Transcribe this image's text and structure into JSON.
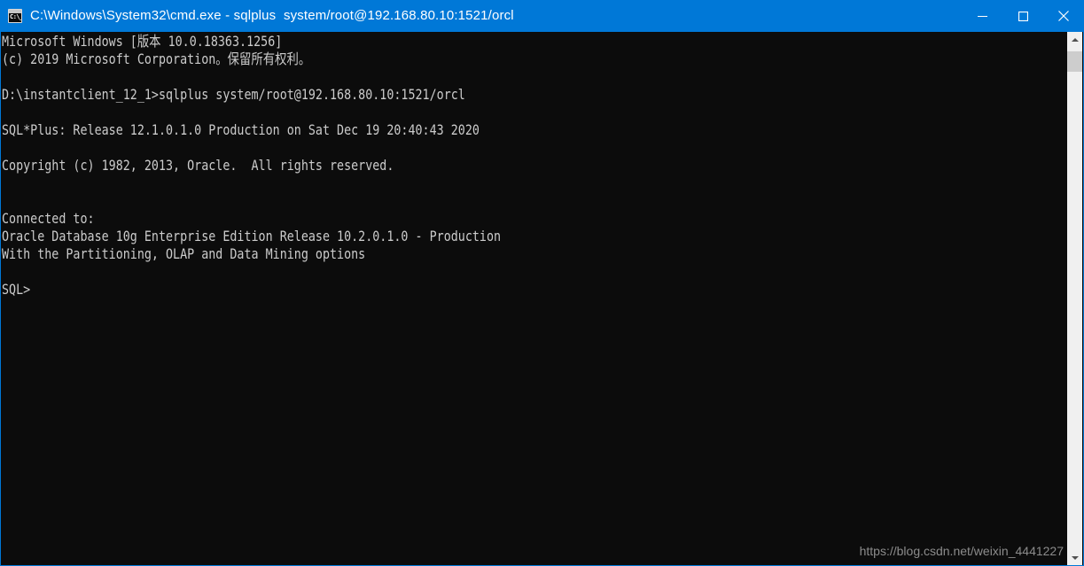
{
  "window": {
    "title": "C:\\Windows\\System32\\cmd.exe - sqlplus  system/root@192.168.80.10:1521/orcl",
    "icon_name": "cmd-console-icon",
    "icon_glyph": "C:\\_",
    "titlebar_color": "#0078d7",
    "background_color": "#0c0c0c",
    "text_color": "#cccccc",
    "border_color": "#0078d7",
    "buttons": {
      "minimize": "minimize",
      "maximize": "maximize",
      "close": "close"
    }
  },
  "console": {
    "lines": [
      "Microsoft Windows [版本 10.0.18363.1256]",
      "(c) 2019 Microsoft Corporation。保留所有权利。",
      "",
      "D:\\instantclient_12_1>sqlplus system/root@192.168.80.10:1521/orcl",
      "",
      "SQL*Plus: Release 12.1.0.1.0 Production on Sat Dec 19 20:40:43 2020",
      "",
      "Copyright (c) 1982, 2013, Oracle.  All rights reserved.",
      "",
      "",
      "Connected to:",
      "Oracle Database 10g Enterprise Edition Release 10.2.0.1.0 - Production",
      "With the Partitioning, OLAP and Data Mining options",
      "",
      "SQL>"
    ]
  },
  "scrollbar": {
    "up_arrow": "scroll-up",
    "down_arrow": "scroll-down",
    "thumb": "scroll-thumb",
    "track_color": "#f0f0f0",
    "thumb_color": "#cdcdcd"
  },
  "watermark": {
    "text": "https://blog.csdn.net/weixin_4441227"
  }
}
